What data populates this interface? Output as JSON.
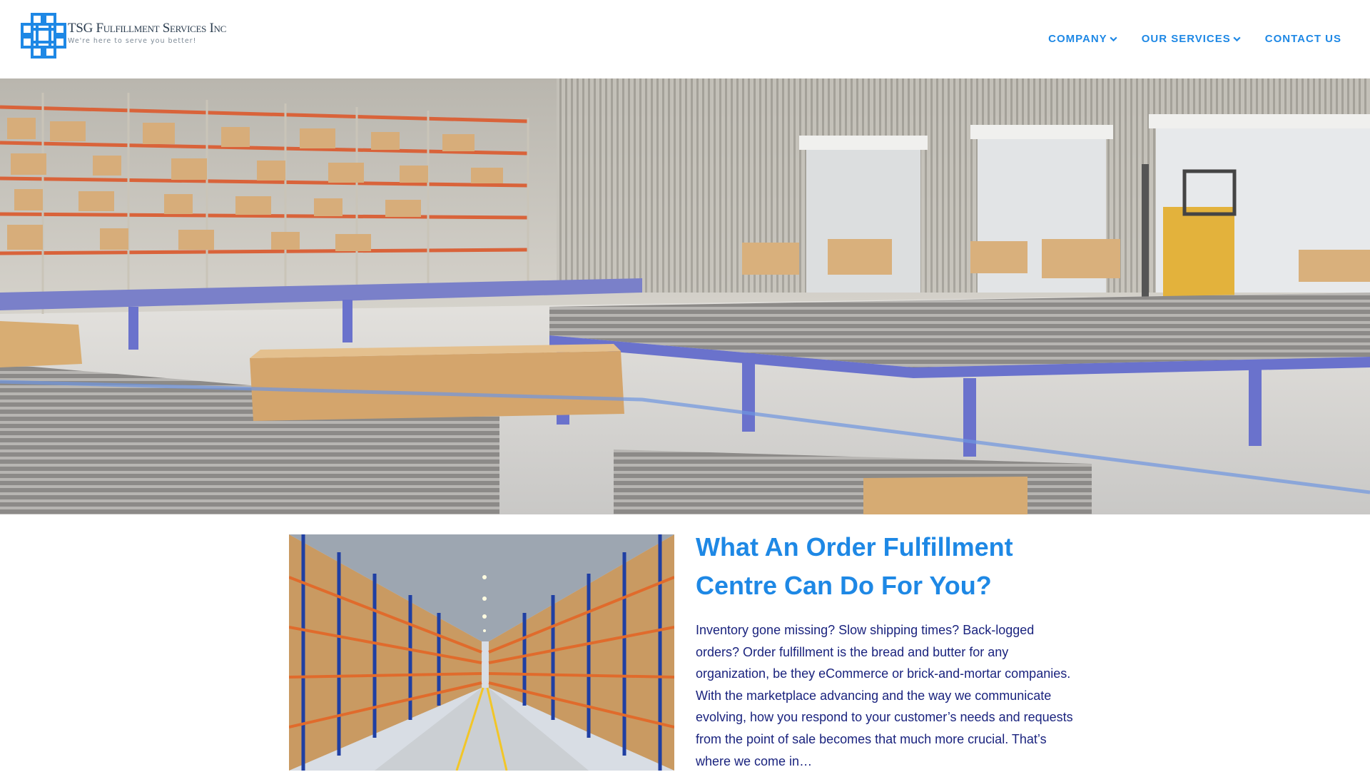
{
  "brand": {
    "name_prefix": "TSG ",
    "name_rest": "Fulfillment Services Inc",
    "tagline": "We're here to serve you better!",
    "color": "#1e88e5"
  },
  "nav": {
    "items": [
      {
        "label": "COMPANY",
        "has_dropdown": true
      },
      {
        "label": "OUR SERVICES",
        "has_dropdown": true
      },
      {
        "label": "CONTACT US",
        "has_dropdown": false
      }
    ]
  },
  "article": {
    "title": "What An Order Fulfillment Centre Can Do For You?",
    "excerpt": "Inventory gone missing? Slow shipping times? Back-logged orders? Order fulfillment is the bread and butter for any organization, be they eCommerce or brick-and-mortar companies. With the marketplace advancing and the way we communicate evolving, how you respond to your customer’s needs and requests from the point of sale becomes that much more crucial. That’s where we come in…"
  },
  "colors": {
    "accent": "#1e88e5",
    "text": "#1a237e"
  }
}
